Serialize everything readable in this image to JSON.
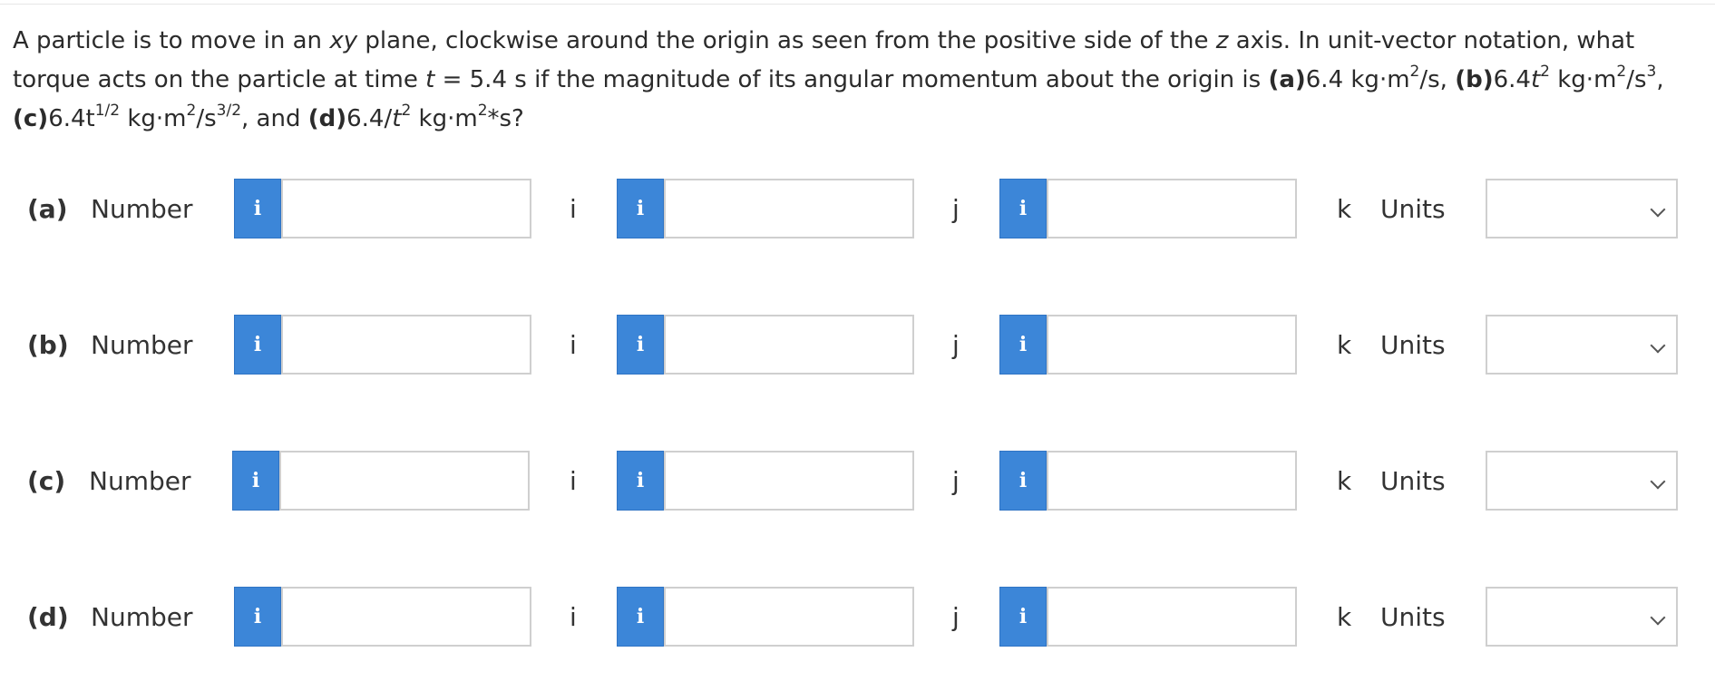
{
  "question": {
    "s1": "A particle is to move in an ",
    "xy": "xy",
    "s2": " plane, clockwise around the origin as seen from the positive side of the ",
    "z": "z",
    "s3": " axis. In unit-vector notation, what torque acts on the particle at time ",
    "t": "t",
    "s4": " = 5.4 s if the magnitude of its angular momentum about the origin is ",
    "a_label": "(a)",
    "a_val": "6.4 kg·m",
    "a_sup": "2",
    "a_tail": "/s, ",
    "b_label": "(b)",
    "b_val": "6.4",
    "b_t": "t",
    "b_sup": "2",
    "b_mid": " kg·m",
    "b_sup2": "2",
    "b_mid2": "/s",
    "b_sup3": "3",
    "b_tail": ", ",
    "c_label": "(c)",
    "c_val": "6.4t",
    "c_sup": "1/2",
    "c_mid": " kg·m",
    "c_sup2": "2",
    "c_mid2": "/s",
    "c_sup3": "3/2",
    "c_tail": ", and ",
    "d_label": "(d)",
    "d_val": "6.4/",
    "d_t": "t",
    "d_sup": "2",
    "d_mid": " kg·m",
    "d_sup2": "2",
    "d_tail": "*s?"
  },
  "number_label": "Number",
  "units_label": "Units",
  "info_glyph": "i",
  "info_icon": "info-icon",
  "unit_vectors": {
    "i": "i",
    "j": "j",
    "k": "k"
  },
  "rows": [
    {
      "part": "(a)",
      "i_value": "",
      "j_value": "",
      "k_value": "",
      "units": ""
    },
    {
      "part": "(b)",
      "i_value": "",
      "j_value": "",
      "k_value": "",
      "units": ""
    },
    {
      "part": "(c)",
      "i_value": "",
      "j_value": "",
      "k_value": "",
      "units": ""
    },
    {
      "part": "(d)",
      "i_value": "",
      "j_value": "",
      "k_value": "",
      "units": ""
    }
  ],
  "colors": {
    "info_button": "#3c86d8",
    "input_border": "#cfcfcf",
    "text": "#2b2b2b"
  }
}
